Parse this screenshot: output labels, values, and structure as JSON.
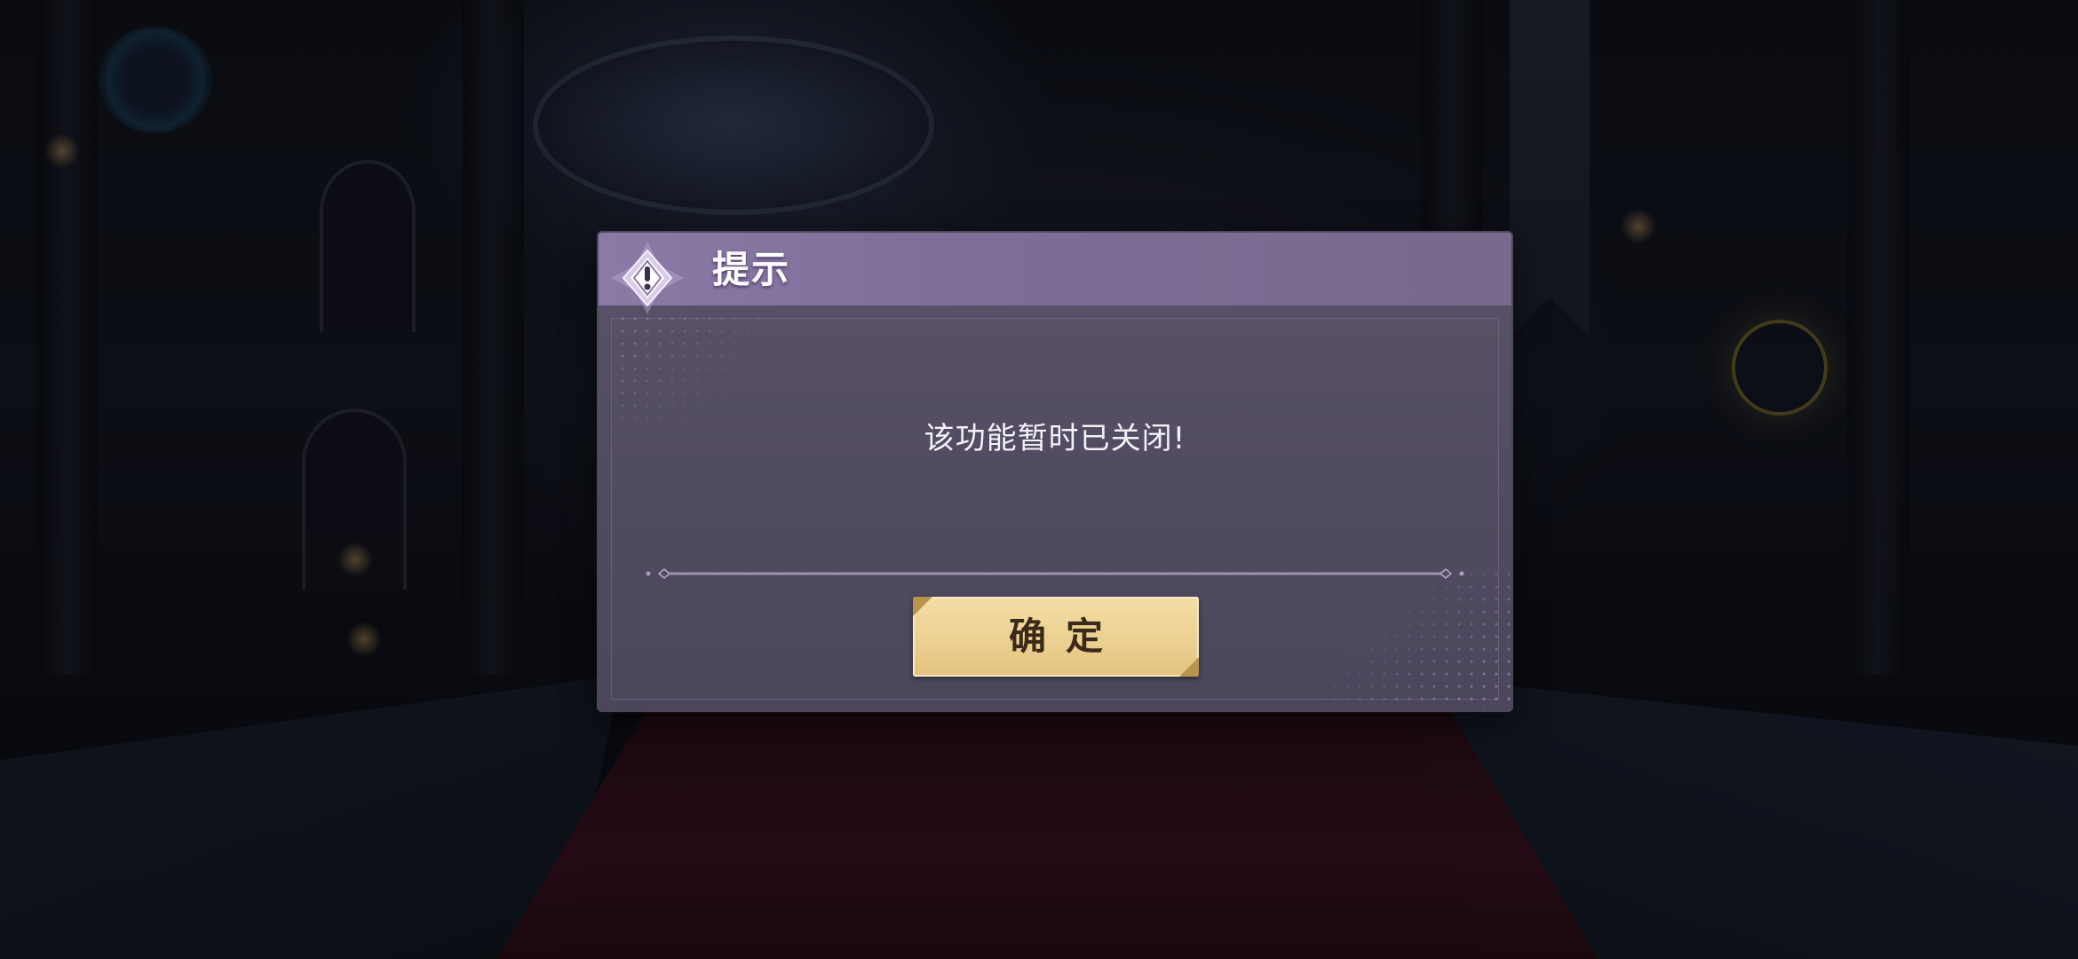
{
  "dialog": {
    "title": "提示",
    "message": "该功能暂时已关闭!",
    "confirm_label": "确定",
    "header_icon": "alert-diamond-icon"
  },
  "colors": {
    "header": "#7e6d98",
    "panel": "#524c62",
    "button": "#ecd092",
    "button_text": "#3a2a18"
  }
}
